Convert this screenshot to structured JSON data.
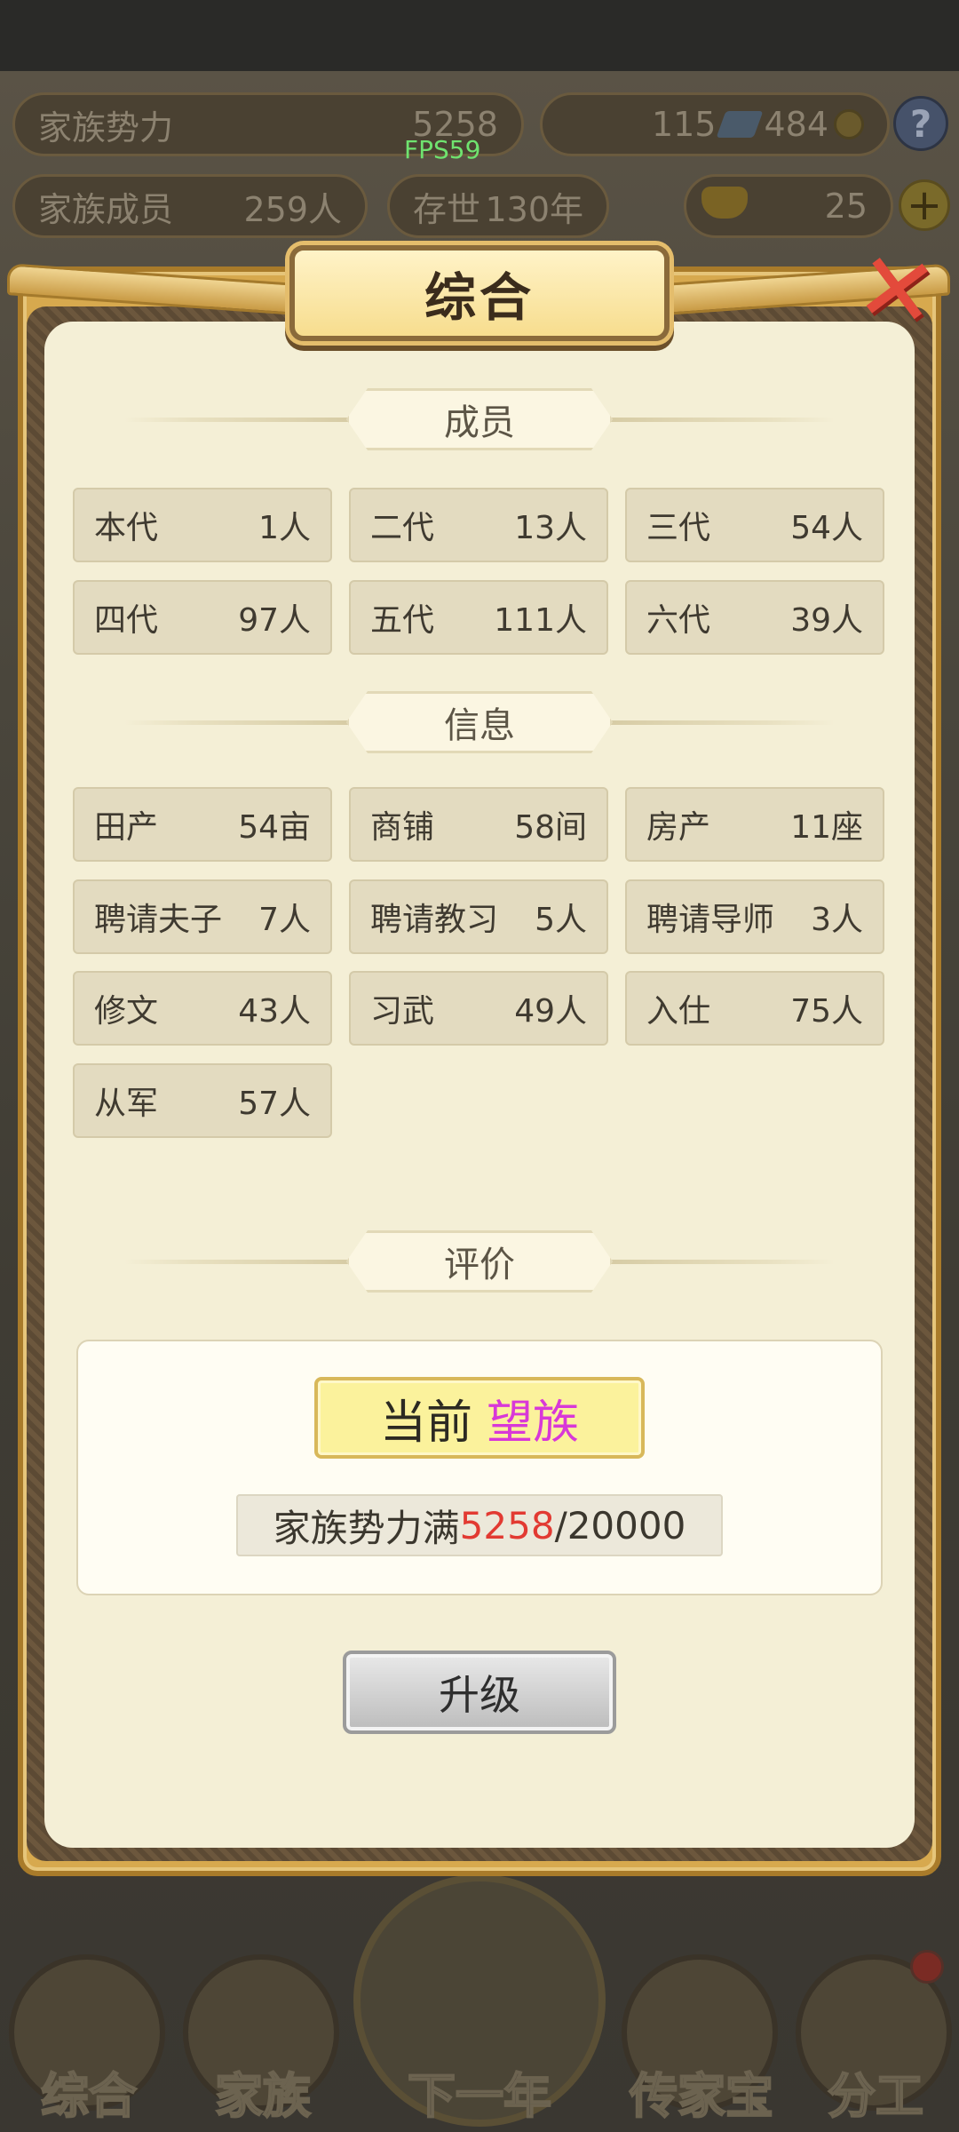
{
  "hud": {
    "power_label": "家族势力",
    "power_value": "5258",
    "fps": "FPS59",
    "books": "115",
    "coins": "484",
    "help": "?",
    "members_label": "家族成员",
    "members_value": "259人",
    "existence_label": "存世",
    "existence_value": "130年",
    "ingots": "25",
    "plus": "+"
  },
  "modal": {
    "title": "综合",
    "close": "✕",
    "members_section": "成员",
    "members": [
      {
        "label": "本代",
        "value": "1人"
      },
      {
        "label": "二代",
        "value": "13人"
      },
      {
        "label": "三代",
        "value": "54人"
      },
      {
        "label": "四代",
        "value": "97人"
      },
      {
        "label": "五代",
        "value": "111人"
      },
      {
        "label": "六代",
        "value": "39人"
      }
    ],
    "info_section": "信息",
    "info": [
      {
        "label": "田产",
        "value": "54亩"
      },
      {
        "label": "商铺",
        "value": "58间"
      },
      {
        "label": "房产",
        "value": "11座"
      },
      {
        "label": "聘请夫子",
        "value": "7人"
      },
      {
        "label": "聘请教习",
        "value": "5人"
      },
      {
        "label": "聘请导师",
        "value": "3人"
      },
      {
        "label": "修文",
        "value": "43人"
      },
      {
        "label": "习武",
        "value": "49人"
      },
      {
        "label": "入仕",
        "value": "75人"
      },
      {
        "label": "从军",
        "value": "57人"
      }
    ],
    "eval_section": "评价",
    "rank_label": "当前",
    "rank_value": "望族",
    "progress_prefix": "家族势力满",
    "progress_current": "5258",
    "progress_target": "/20000",
    "upgrade": "升级"
  },
  "bottom_nav": [
    "综合",
    "家族",
    "下一年",
    "传家宝",
    "分工"
  ]
}
